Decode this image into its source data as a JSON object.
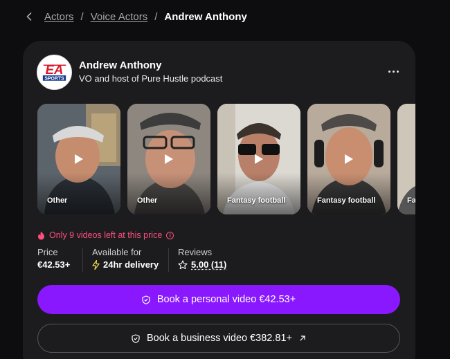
{
  "breadcrumb": {
    "items": [
      "Actors",
      "Voice Actors"
    ],
    "separator": "/",
    "current": "Andrew Anthony"
  },
  "profile": {
    "name": "Andrew Anthony",
    "tagline": "VO and host of Pure Hustle podcast",
    "avatar_logo": {
      "line1": "EA",
      "line2": "SPORTS"
    }
  },
  "videos": [
    {
      "label": "Other"
    },
    {
      "label": "Other"
    },
    {
      "label": "Fantasy football"
    },
    {
      "label": "Fantasy football"
    },
    {
      "label": "Fa"
    }
  ],
  "scarcity": {
    "text": "Only 9 videos left at this price",
    "icon": "fire-icon"
  },
  "stats": {
    "price_label": "Price",
    "price_value": "€42.53+",
    "availability_label": "Available for",
    "availability_value": "24hr delivery",
    "reviews_label": "Reviews",
    "reviews_value": "5.00 (11)"
  },
  "actions": {
    "personal": "Book a personal video €42.53+",
    "business": "Book a business video €382.81+"
  },
  "colors": {
    "accent": "#8a18ff",
    "scarcity": "#ff4f7b",
    "card": "#1c1c1f",
    "background": "#0d0d0f"
  }
}
